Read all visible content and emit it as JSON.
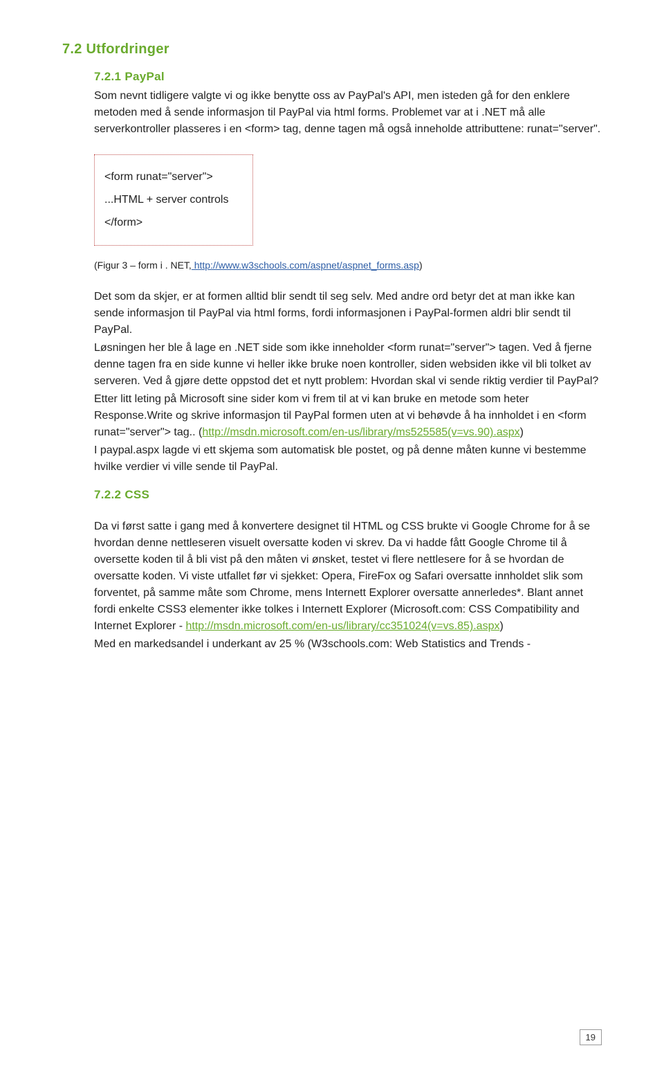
{
  "headings": {
    "h1": "7.2 Utfordringer",
    "h2a": "7.2.1 PayPal",
    "h2b": "7.2.2 CSS"
  },
  "paypal": {
    "p1": "Som nevnt tidligere valgte vi og ikke benytte oss av PayPal's API, men isteden gå for den enklere metoden med å sende informasjon til PayPal via html forms. Problemet var at i .NET må alle serverkontroller plasseres i en <form> tag, denne tagen må også inneholde attributtene: runat=\"server\".",
    "code": {
      "l1": "<form runat=\"server\">",
      "l2": "...HTML + server controls",
      "l3": "</form>"
    },
    "citation_prefix": "(Figur 3 – form i . NET,",
    "citation_link": " http://www.w3schools.com/aspnet/aspnet_forms.asp",
    "citation_suffix": ")",
    "p2a": "Det som da skjer, er at formen alltid blir sendt til seg selv. Med andre ord betyr det at man ikke kan sende informasjon til PayPal via html forms, fordi informasjonen i PayPal-formen aldri blir sendt til PayPal.",
    "p2b": "Løsningen her ble å lage en .NET side som ikke inneholder <form runat=\"server\"> tagen. Ved å fjerne denne tagen fra en side kunne vi heller ikke bruke noen kontroller, siden websiden ikke vil bli tolket av serveren. Ved å gjøre dette oppstod det et nytt problem: Hvordan skal vi sende riktig verdier til PayPal?",
    "p2c_pre": "Etter litt leting på Microsoft sine sider kom vi frem til at vi kan bruke en metode som heter Response.Write og skrive informasjon til PayPal formen uten at vi behøvde å ha innholdet i en <form runat=\"server\"> tag.. (",
    "p2c_link": "http://msdn.microsoft.com/en-us/library/ms525585(v=vs.90).aspx",
    "p2c_post": ")",
    "p2d": "I paypal.aspx lagde vi ett skjema som automatisk ble postet, og på denne måten kunne vi bestemme hvilke verdier vi ville sende til PayPal."
  },
  "css": {
    "p1_pre": "Da vi først satte i gang med å konvertere designet til HTML og CSS brukte vi Google Chrome for å se hvordan denne nettleseren visuelt oversatte koden vi skrev. Da vi hadde fått Google Chrome til å oversette koden til å bli vist på den måten vi ønsket, testet vi flere nettlesere for å se hvordan de oversatte koden. Vi viste utfallet før vi sjekket: Opera, FireFox og Safari oversatte innholdet slik som forventet, på samme måte som Chrome, mens Internett Explorer oversatte annerledes*. Blant annet fordi enkelte CSS3 elementer ikke tolkes i Internett Explorer (Microsoft.com: CSS Compatibility and Internet Explorer - ",
    "p1_link": "http://msdn.microsoft.com/en-us/library/cc351024(v=vs.85).aspx",
    "p1_post": ")",
    "p2": "Med en markedsandel i underkant av 25 % (W3schools.com: Web Statistics and Trends -"
  },
  "page_number": "19"
}
